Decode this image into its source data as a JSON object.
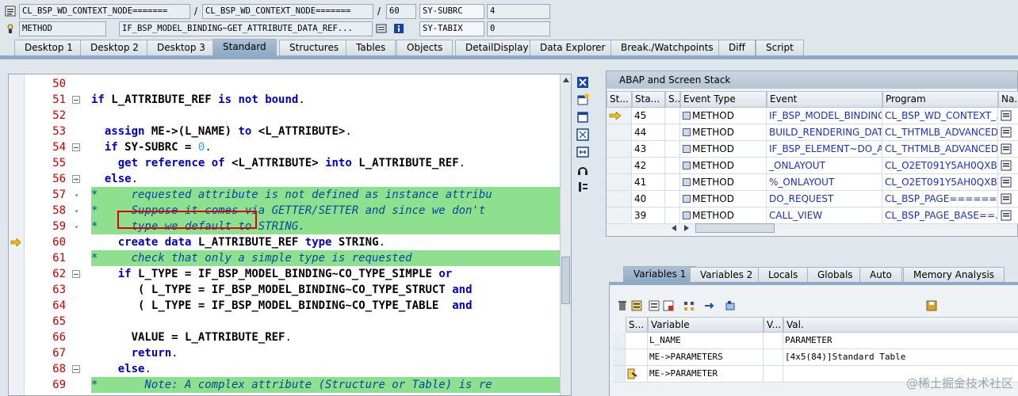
{
  "header": {
    "class_field": "CL_BSP_WD_CONTEXT_NODE=======",
    "class_sep": "/",
    "program_field": "CL_BSP_WD_CONTEXT_NODE=======",
    "line_sep": "/",
    "line_field": "60",
    "subrc_label": "SY-SUBRC",
    "subrc_value": "4",
    "type_field": "METHOD",
    "method_field": "IF_BSP_MODEL_BINDING~GET_ATTRIBUTE_DATA_REF...",
    "tabix_label": "SY-TABIX",
    "tabix_value": "0"
  },
  "tabs": [
    {
      "label": "Desktop 1"
    },
    {
      "label": "Desktop 2"
    },
    {
      "label": "Desktop 3"
    },
    {
      "label": "Standard"
    },
    {
      "label": "Structures"
    },
    {
      "label": "Tables"
    },
    {
      "label": "Objects"
    },
    {
      "label": "DetailDisplay"
    },
    {
      "label": "Data Explorer"
    },
    {
      "label": "Break./Watchpoints"
    },
    {
      "label": "Diff"
    },
    {
      "label": "Script"
    }
  ],
  "active_tab": "Standard",
  "code": {
    "lines": [
      {
        "num": "50",
        "text": ""
      },
      {
        "num": "51",
        "text": "if L_ATTRIBUTE_REF is not bound."
      },
      {
        "num": "52",
        "text": ""
      },
      {
        "num": "53",
        "text": "  assign ME->(L_NAME) to <L_ATTRIBUTE>."
      },
      {
        "num": "54",
        "text": "  if SY-SUBRC = 0."
      },
      {
        "num": "55",
        "text": "    get reference of <L_ATTRIBUTE> into L_ATTRIBUTE_REF."
      },
      {
        "num": "56",
        "text": "  else."
      },
      {
        "num": "57",
        "text": "*     requested attribute is not defined as instance attribu"
      },
      {
        "num": "58",
        "text": "*     Suppose it comes via GETTER/SETTER and since we don't"
      },
      {
        "num": "59",
        "text": "*     type we default to STRING."
      },
      {
        "num": "60",
        "text": "    create data L_ATTRIBUTE_REF type STRING."
      },
      {
        "num": "61",
        "text": "*     check that only a simple type is requested"
      },
      {
        "num": "62",
        "text": "    if L_TYPE = IF_BSP_MODEL_BINDING~CO_TYPE_SIMPLE or"
      },
      {
        "num": "63",
        "text": "       ( L_TYPE = IF_BSP_MODEL_BINDING~CO_TYPE_STRUCT and"
      },
      {
        "num": "64",
        "text": "       ( L_TYPE = IF_BSP_MODEL_BINDING~CO_TYPE_TABLE  and"
      },
      {
        "num": "65",
        "text": ""
      },
      {
        "num": "66",
        "text": "      VALUE = L_ATTRIBUTE_REF."
      },
      {
        "num": "67",
        "text": "      return."
      },
      {
        "num": "68",
        "text": "    else."
      },
      {
        "num": "69",
        "text": "*       Note: A complex attribute (Structure or Table) is re"
      }
    ]
  },
  "stack": {
    "title": "ABAP and Screen Stack",
    "columns": [
      "St...",
      "Sta...",
      "S...",
      "Event Type",
      "Event",
      "Program",
      "Na..."
    ],
    "rows": [
      {
        "level": "45",
        "event_type": "METHOD",
        "event": "IF_BSP_MODEL_BINDING...",
        "program": "CL_BSP_WD_CONTEXT_...",
        "current": true
      },
      {
        "level": "44",
        "event_type": "METHOD",
        "event": "BUILD_RENDERING_DATA",
        "program": "CL_THTMLB_ADVANCED...",
        "current": false
      },
      {
        "level": "43",
        "event_type": "METHOD",
        "event": "IF_BSP_ELEMENT~DO_A...",
        "program": "CL_THTMLB_ADVANCED...",
        "current": false
      },
      {
        "level": "42",
        "event_type": "METHOD",
        "event": "_ONLAYOUT",
        "program": "CL_O2ET091Y5AH0QXB...",
        "current": false
      },
      {
        "level": "41",
        "event_type": "METHOD",
        "event": "%_ONLAYOUT",
        "program": "CL_O2ET091Y5AH0QXB...",
        "current": false
      },
      {
        "level": "40",
        "event_type": "METHOD",
        "event": "DO_REQUEST",
        "program": "CL_BSP_PAGE=======...",
        "current": false
      },
      {
        "level": "39",
        "event_type": "METHOD",
        "event": "CALL_VIEW",
        "program": "CL_BSP_PAGE_BASE==...",
        "current": false
      }
    ]
  },
  "var_tabs": [
    {
      "label": "Variables 1"
    },
    {
      "label": "Variables 2"
    },
    {
      "label": "Locals"
    },
    {
      "label": "Globals"
    },
    {
      "label": "Auto"
    },
    {
      "label": "Memory Analysis"
    }
  ],
  "variables": {
    "columns": [
      "S...",
      "Variable",
      "V...",
      "Val."
    ],
    "rows": [
      {
        "name": "L_NAME",
        "value": "PARAMETER"
      },
      {
        "name": "ME->PARAMETERS",
        "value": "[4x5(84)]Standard Table"
      },
      {
        "name": "ME->PARAMETER",
        "value": ""
      }
    ]
  },
  "watermark": "@稀土掘金技术社区",
  "colors": {
    "tab_active": "#8eaac4",
    "comment_bg": "#8ee08e",
    "keyword": "#0000c0",
    "line_number": "#d00000",
    "highlight": "#e00000"
  }
}
